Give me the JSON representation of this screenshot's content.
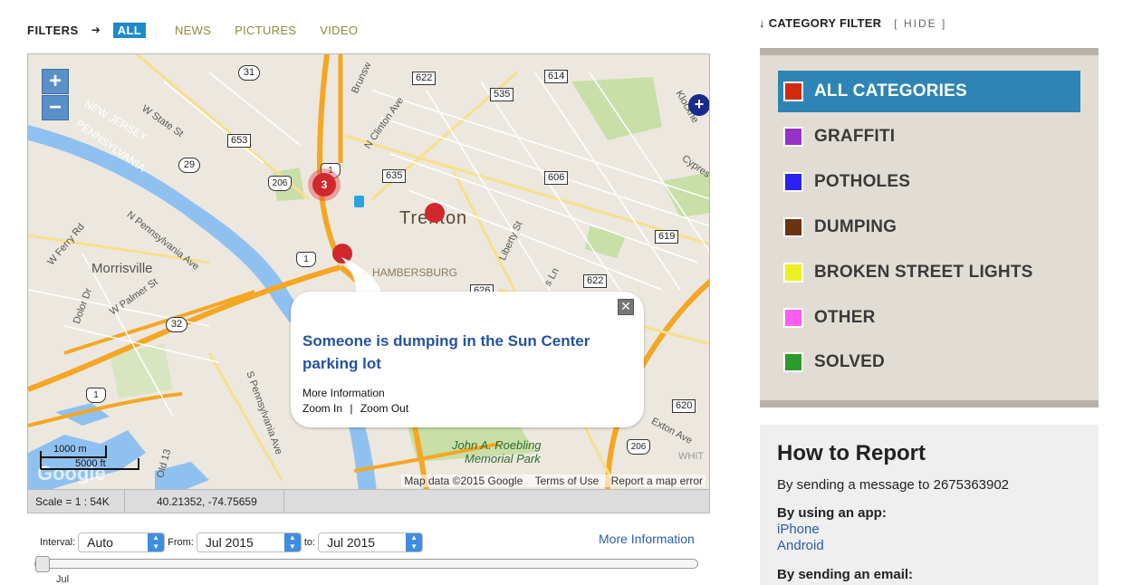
{
  "filters": {
    "label": "FILTERS",
    "arrow": "➔",
    "tabs": [
      "ALL",
      "NEWS",
      "PICTURES",
      "VIDEO"
    ],
    "active_tab": "ALL"
  },
  "map": {
    "zoom_in": "+",
    "zoom_out": "−",
    "cities": {
      "trenton": "Trenton",
      "morrisville": "Morrisville",
      "hambersburg": "HAMBERSBURG"
    },
    "state_label_1": "NEW JERSEY",
    "state_label_2": "PENNSYLVANIA",
    "streets": {
      "w_state": "W State St",
      "n_clinton": "N Clinton Ave",
      "brunswick": "Brunsw",
      "n_penn": "N Pennsylvania Ave",
      "w_ferry": "W Ferry Rd",
      "w_palmer": "W Palmer St",
      "dolor": "Dolor Dr",
      "s_penn": "S Pennsylvania Ave",
      "old13": "Old 13",
      "liberty": "Liberty St",
      "exton": "Exton Ave",
      "cypress": "Cypres",
      "klockner": "Klockne",
      "whit": "WHIT",
      "s_ln": "s Ln"
    },
    "route_shields": [
      "31",
      "622",
      "614",
      "535",
      "653",
      "635",
      "606",
      "29",
      "206",
      "619",
      "626",
      "622",
      "32",
      "620",
      "206"
    ],
    "interstate_shields": [
      "1",
      "1",
      "1"
    ],
    "park": {
      "line1": "John A. Roebling",
      "line2": "Memorial Park"
    },
    "cluster_count": "3",
    "nav_plus": "+",
    "popup": {
      "title": "Someone is dumping in the Sun Center parking lot",
      "more_info": "More Information",
      "zoom_in": "Zoom In",
      "separator": "|",
      "zoom_out": "Zoom Out",
      "close": "✕"
    },
    "attribution": {
      "data": "Map data ©2015 Google",
      "terms": "Terms of Use",
      "report": "Report a map error"
    },
    "scale": {
      "meters": "1000 m",
      "feet": "5000 ft"
    },
    "google_logo": "Google",
    "status": {
      "scale": "Scale = 1 : 54K",
      "coordinates": "40.21352, -74.75659"
    }
  },
  "controls": {
    "interval_label": "Interval:",
    "interval_value": "Auto",
    "from_label": "From:",
    "from_value": "Jul 2015",
    "to_label": "to:",
    "to_value": "Jul 2015",
    "more_info": "More Information",
    "slider_label": "Jul",
    "slider_position": 0
  },
  "category_filter": {
    "heading": "CATEGORY FILTER",
    "hide": "[ HIDE ]",
    "items": [
      {
        "label": "ALL CATEGORIES",
        "color": "#d22a0e",
        "active": true
      },
      {
        "label": "GRAFFITI",
        "color": "#9b30c8",
        "active": false
      },
      {
        "label": "POTHOLES",
        "color": "#2a22f0",
        "active": false
      },
      {
        "label": "DUMPING",
        "color": "#6b3410",
        "active": false
      },
      {
        "label": "BROKEN STREET LIGHTS",
        "color": "#eef022",
        "active": false
      },
      {
        "label": "OTHER",
        "color": "#ff5cf0",
        "active": false
      },
      {
        "label": "SOLVED",
        "color": "#2a9a2a",
        "active": false
      }
    ]
  },
  "how_to_report": {
    "title": "How to Report",
    "message_line": "By sending a message to 2675363902",
    "app_heading": "By using an app:",
    "apps": [
      "iPhone",
      "Android"
    ],
    "email_heading": "By sending an email:"
  },
  "colors": {
    "accent": "#1e8ac8",
    "active_category": "#2e85b5",
    "link": "#2a5ea8",
    "popup_title": "#24539e",
    "marker": "#d0282c"
  }
}
